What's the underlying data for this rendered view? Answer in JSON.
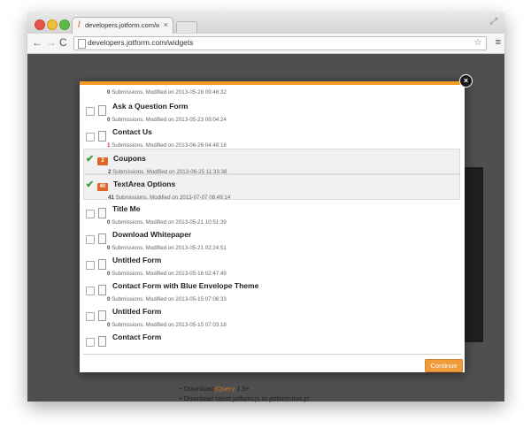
{
  "browser": {
    "tab_title": "developers.jotform.com/w",
    "tab_close": "×",
    "url": "developers.jotform.com/widgets",
    "favicon": "/"
  },
  "icons": {
    "back": "←",
    "forward": "→",
    "reload": "C",
    "star": "☆",
    "menu": "≡",
    "fullscreen": "⤢",
    "dialog_close": "×",
    "check": "✔"
  },
  "background_page": {
    "line1_prefix": "Download ",
    "line1_link": "jQuery",
    "line1_suffix": " 1.9+",
    "line2": "Download latest jotform.js or jotform.min.js"
  },
  "dialog": {
    "first_meta": {
      "count": "0",
      "text": " Submissions.  Modified on 2013-05-28 09:46:32"
    },
    "forms": [
      {
        "title": "Ask a Question Form",
        "count": "0",
        "meta": " Submissions.  Modified on 2013-05-23 09:04:24",
        "checked": false,
        "badge": ""
      },
      {
        "title": "Contact Us",
        "count": "1",
        "meta": " Submissions.  Modified on 2013-06-26 04:48:18",
        "checked": false,
        "badge": ""
      },
      {
        "title": "Coupons",
        "count": "2",
        "meta": " Submissions.  Modified on 2013-06-25 11:33:38",
        "checked": true,
        "badge": "2"
      },
      {
        "title": "TextArea Options",
        "count": "41",
        "meta": " Submissions.  Modified on 2013-07-07 08:49:14",
        "checked": true,
        "badge": "40"
      },
      {
        "title": "Title Me",
        "count": "0",
        "meta": " Submissions.  Modified on 2013-05-21 10:51:39",
        "checked": false,
        "badge": ""
      },
      {
        "title": "Download Whitepaper",
        "count": "0",
        "meta": " Submissions.  Modified on 2013-05-21 02:24:51",
        "checked": false,
        "badge": ""
      },
      {
        "title": "Untitled Form",
        "count": "0",
        "meta": " Submissions.  Modified on 2013-05-16 02:47:49",
        "checked": false,
        "badge": ""
      },
      {
        "title": "Contact Form with Blue Envelope Theme",
        "count": "0",
        "meta": " Submissions.  Modified on 2013-05-15 07:06:33",
        "checked": false,
        "badge": ""
      },
      {
        "title": "Untitled Form",
        "count": "0",
        "meta": " Submissions.  Modified on 2013-05-15 07:03:18",
        "checked": false,
        "badge": ""
      },
      {
        "title": "Contact Form",
        "count": "",
        "meta": "",
        "checked": false,
        "badge": ""
      }
    ],
    "continue_label": "Continue"
  },
  "colors": {
    "accent": "#f39b23",
    "check": "#3e9c2f",
    "badge": "#e0652a",
    "count_highlight": "#c62f2f"
  }
}
